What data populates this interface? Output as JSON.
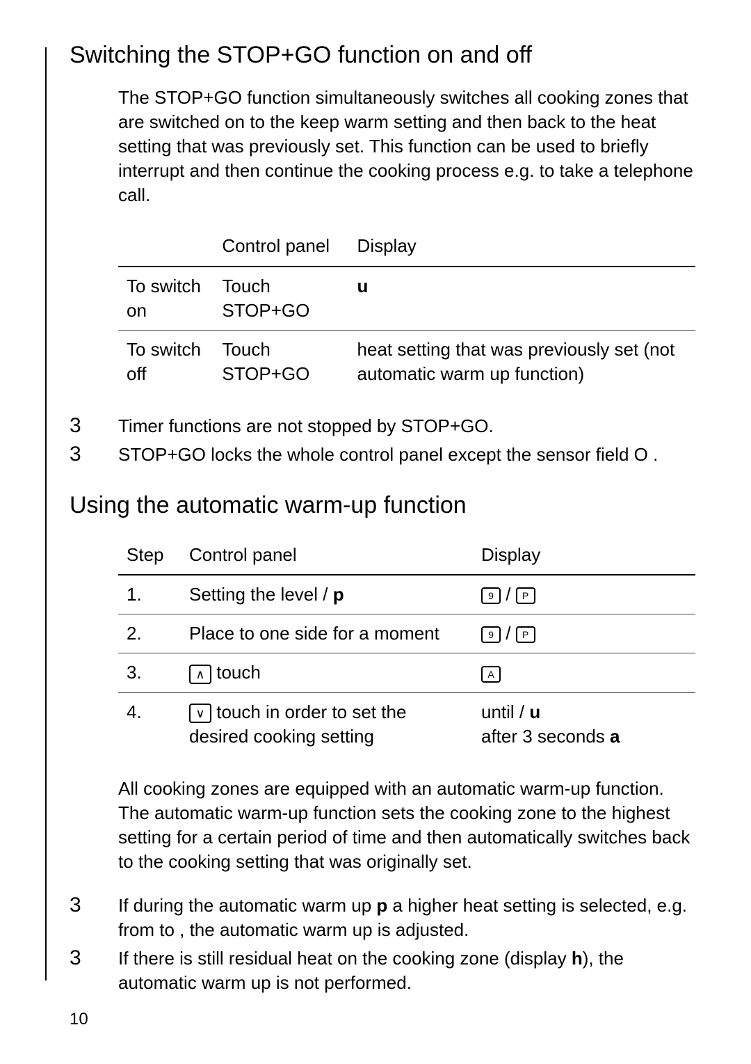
{
  "section1": {
    "heading": "Switching the STOP+GO function on and off",
    "intro": "The STOP+GO function simultaneously switches all cooking zones that are switched on to the keep warm setting and then back to the heat setting that was previously set. This function can be used to briefly interrupt and then continue the cooking process e.g. to take a telephone call.",
    "table": {
      "headers": [
        "",
        "Control panel",
        "Display"
      ],
      "rows": [
        {
          "c0": "To switch on",
          "c1": "Touch STOP+GO",
          "c2": "u"
        },
        {
          "c0": "To switch off",
          "c1": "Touch STOP+GO",
          "c2": "heat setting that was previously set (not automatic warm up function)"
        }
      ]
    },
    "notes": [
      "Timer functions are not stopped by STOP+GO.",
      "STOP+GO locks the whole control panel except the sensor field O ."
    ]
  },
  "section2": {
    "heading": "Using the automatic warm-up function",
    "table": {
      "headers": [
        "Step",
        "Control panel",
        "Display"
      ],
      "rows": [
        {
          "step": "1.",
          "panel_prefix": "Setting the level  / ",
          "panel_bold": "p",
          "display_type": "icons1"
        },
        {
          "step": "2.",
          "panel_prefix": "Place to one side for a moment",
          "panel_bold": "",
          "display_type": "icons1"
        },
        {
          "step": "3.",
          "panel_prefix": " touch",
          "panel_bold": "",
          "display_type": "iconA",
          "panel_icon": "up"
        },
        {
          "step": "4.",
          "panel_prefix": " touch in order to set the desired cooking setting",
          "panel_bold": "",
          "panel_icon": "down",
          "display_line1a": "until   / ",
          "display_line1b": "u",
          "display_line2a": "after 3 seconds ",
          "display_line2b": "a"
        }
      ]
    },
    "para": "All cooking zones are equipped with an automatic warm-up function. The automatic warm-up function sets the cooking zone to the highest setting for a certain period of time and then automatically switches back to the cooking setting that was originally set.",
    "notes": [
      {
        "pre": "If during the automatic warm up ",
        "bold": "p",
        "post": " a higher heat setting is selected, e.g. from   to   , the automatic warm up is adjusted."
      },
      {
        "pre": "If there is still residual heat on the cooking zone (display ",
        "bold": "h",
        "post": "), the automatic warm up is not performed."
      }
    ]
  },
  "page_number": "10",
  "marker": "3"
}
